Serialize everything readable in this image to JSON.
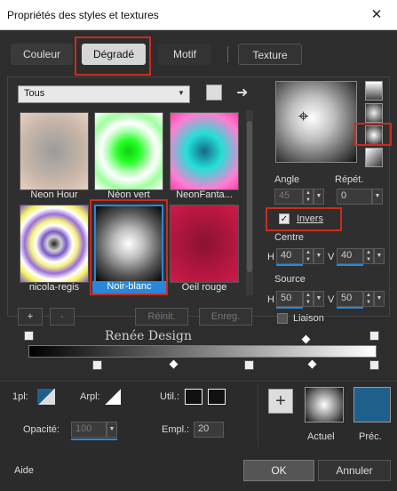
{
  "window": {
    "title": "Propriétés des styles et textures",
    "close": "✕"
  },
  "tabs": [
    "Couleur",
    "Dégradé",
    "Motif",
    "Texture"
  ],
  "dropdown": {
    "value": "Tous"
  },
  "gradients": [
    {
      "name": "Neon Hour"
    },
    {
      "name": "Néon vert"
    },
    {
      "name": "NeonFanta..."
    },
    {
      "name": "nicola-regis"
    },
    {
      "name": "Noir-blanc"
    },
    {
      "name": "Oeil rouge"
    }
  ],
  "angle": {
    "label": "Angle",
    "value": "45"
  },
  "repet": {
    "label": "Répét.",
    "value": "0"
  },
  "invers": {
    "label": "Invers",
    "checked": true
  },
  "centre": {
    "label": "Centre",
    "h_label": "H",
    "h": "40",
    "v_label": "V",
    "v": "40"
  },
  "source": {
    "label": "Source",
    "h_label": "H",
    "h": "50",
    "v_label": "V",
    "v": "50"
  },
  "liaison": {
    "label": "Liaison",
    "checked": false
  },
  "editor": {
    "add": "+",
    "remove": "-",
    "reset": "Réinit.",
    "save": "Enreg."
  },
  "watermark": "Renée Design",
  "bottom": {
    "pl_label": "1pl:",
    "arpl_label": "Arpl:",
    "util_label": "Util.:",
    "opacity_label": "Opacité:",
    "opacity_value": "100",
    "empl_label": "Empl.:",
    "empl_value": "20",
    "actuel": "Actuel",
    "prec": "Préc.",
    "plus": "+"
  },
  "footer": {
    "help": "Aide",
    "ok": "OK",
    "cancel": "Annuler"
  },
  "colors": {
    "accent": "#2a86d8",
    "highlight": "#cc2b1f",
    "prec_swatch": "#1f5f8c"
  }
}
